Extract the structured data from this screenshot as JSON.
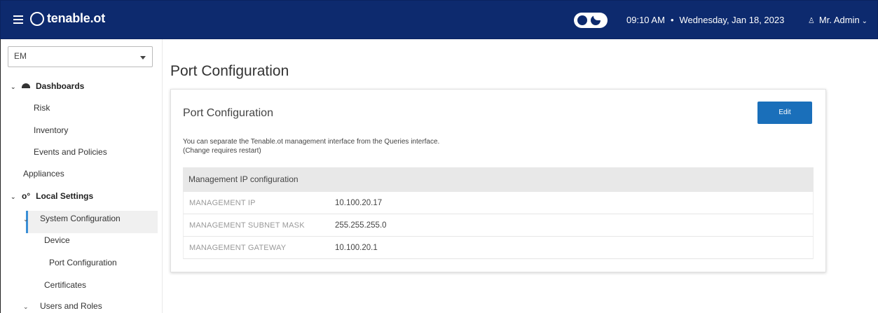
{
  "topbar": {
    "brand": "tenable.ot",
    "time": "09:10 AM",
    "separator": "•",
    "date": "Wednesday, Jan 18, 2023",
    "user": "Mr. Admin",
    "background": "#0d2a6e"
  },
  "sidebar": {
    "site_select": "EM",
    "items": [
      {
        "label": "Dashboards"
      },
      {
        "label": "Risk"
      },
      {
        "label": "Inventory"
      },
      {
        "label": "Events and Policies"
      },
      {
        "label": "Appliances"
      },
      {
        "label": "Local Settings"
      },
      {
        "label": "System Configuration"
      },
      {
        "label": "Device"
      },
      {
        "label": "Port Configuration"
      },
      {
        "label": "Certificates"
      },
      {
        "label": "Users and Roles"
      }
    ],
    "active_color": "#3a8fd6"
  },
  "main": {
    "page_title": "Port Configuration",
    "card": {
      "title": "Port Configuration",
      "edit_label": "Edit",
      "description": "You can separate the Tenable.ot management interface from the Queries interface. (Change requires restart)",
      "table_header": "Management IP configuration",
      "rows": [
        {
          "key": "MANAGEMENT IP",
          "value": "10.100.20.17"
        },
        {
          "key": "MANAGEMENT SUBNET MASK",
          "value": "255.255.255.0"
        },
        {
          "key": "MANAGEMENT GATEWAY",
          "value": "10.100.20.1"
        }
      ]
    },
    "accent": "#1a6fba"
  }
}
